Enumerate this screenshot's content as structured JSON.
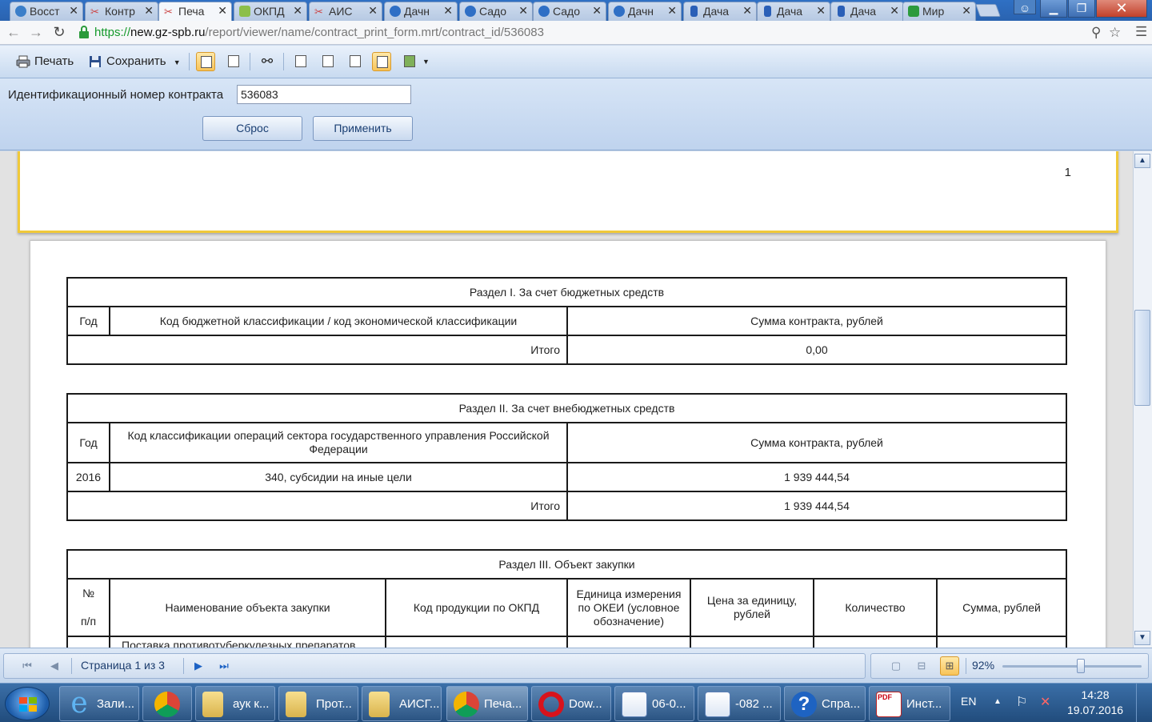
{
  "browser": {
    "tabs": [
      {
        "label": "Восст",
        "icon": "opera-favicon",
        "color": "#3a7ec9"
      },
      {
        "label": "Контр",
        "icon": "tools-favicon",
        "color": "#c44"
      },
      {
        "label": "Печа",
        "icon": "tools-favicon",
        "color": "#c44"
      },
      {
        "label": "ОКПД",
        "icon": "doc-favicon",
        "color": "#8cbf4a"
      },
      {
        "label": "АИС",
        "icon": "tools-favicon",
        "color": "#c44"
      },
      {
        "label": "Дачн",
        "icon": "hand-favicon",
        "color": "#2f6fc5"
      },
      {
        "label": "Садо",
        "icon": "hand-favicon",
        "color": "#2f6fc5"
      },
      {
        "label": "Садо",
        "icon": "hand-favicon",
        "color": "#2f6fc5"
      },
      {
        "label": "Дачн",
        "icon": "hand-favicon",
        "color": "#2f6fc5"
      },
      {
        "label": "Дача",
        "icon": "bookmark-favicon",
        "color": "#2a5fb7"
      },
      {
        "label": "Дача",
        "icon": "bookmark-favicon",
        "color": "#2a5fb7"
      },
      {
        "label": "Дача",
        "icon": "bookmark-favicon",
        "color": "#2a5fb7"
      },
      {
        "label": "Мир",
        "icon": "mk-favicon",
        "color": "#2c9a3d"
      }
    ],
    "url": {
      "scheme": "https://",
      "host": "new.gz-spb.ru",
      "path": "/report/viewer/name/contract_print_form.mrt/contract_id/536083"
    }
  },
  "toolbar": {
    "print_label": "Печать",
    "save_label": "Сохранить"
  },
  "params": {
    "label": "Идентификационный номер контракта",
    "value": "536083",
    "reset_label": "Сброс",
    "apply_label": "Применить"
  },
  "report": {
    "page_number": "1",
    "section1": {
      "title": "Раздел I. За счет бюджетных средств",
      "col_year": "Год",
      "col_code": "Код бюджетной классификации / код экономической классификации",
      "col_sum": "Сумма контракта, рублей",
      "total_label": "Итого",
      "total_value": "0,00"
    },
    "section2": {
      "title": "Раздел II. За счет внебюджетных средств",
      "col_year": "Год",
      "col_code": "Код классификации операций сектора государственного управления Российской Федерации",
      "col_sum": "Сумма контракта, рублей",
      "row_year": "2016",
      "row_code": "340, субсидии на иные цели",
      "row_sum": "1 939 444,54",
      "total_label": "Итого",
      "total_value": "1 939 444,54"
    },
    "section3": {
      "title": "Раздел III. Объект закупки",
      "col_num_top": "№",
      "col_num_bottom": "п/п",
      "col_name": "Наименование объекта закупки",
      "col_okpd": "Код продукции по ОКПД",
      "col_unit": "Единица измерения по ОКЕИ (условное обозначение)",
      "col_price": "Цена за единицу, рублей",
      "col_qty": "Количество",
      "col_sum": "Сумма, рублей",
      "partial_row": "Поставка противотуберкулезных препаратов"
    }
  },
  "status": {
    "page_info": "Страница 1 из 3",
    "zoom": "92%",
    "zoom_level": 0.92
  },
  "taskbar": {
    "buttons": [
      {
        "label": "Зали...",
        "icon": "ie-icon"
      },
      {
        "label": "",
        "icon": "chrome-icon"
      },
      {
        "label": "аук к...",
        "icon": "folder-icon"
      },
      {
        "label": "Прот...",
        "icon": "folder-icon"
      },
      {
        "label": "АИСГ...",
        "icon": "folder-icon"
      },
      {
        "label": "Печа...",
        "icon": "chrome-icon"
      },
      {
        "label": "Dow...",
        "icon": "opera-icon"
      },
      {
        "label": "06-0...",
        "icon": "word-icon"
      },
      {
        "label": "-082 ...",
        "icon": "word-icon"
      },
      {
        "label": "Спра...",
        "icon": "help-icon"
      },
      {
        "label": "Инст...",
        "icon": "pdf-icon"
      }
    ],
    "language": "EN",
    "time": "14:28",
    "date": "19.07.2016"
  }
}
